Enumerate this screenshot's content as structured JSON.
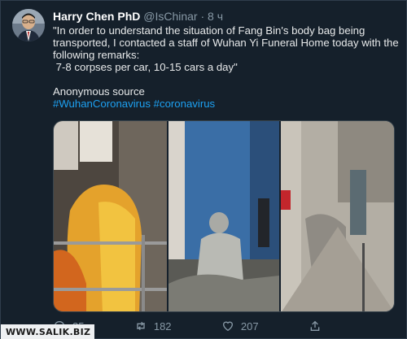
{
  "tweet": {
    "author_name": "Harry Chen PhD",
    "handle": "@IsChinar",
    "separator": "·",
    "time": "8 ч",
    "text_quote": "\"In order to understand the situation of Fang Bin's body bag being transported, I contacted a staff of Wuhan Yi Funeral Home today with the following remarks:\n 7-8 corpses per car, 10-15 cars a day\"",
    "source": "Anonymous source",
    "hashtags": "#WuhanCoronavirus #coronavirus"
  },
  "actions": {
    "replies": "25",
    "retweets": "182",
    "likes": "207"
  },
  "watermark": "WWW.SALIK.BIZ",
  "icons": [
    "reply-icon",
    "retweet-icon",
    "like-icon",
    "share-icon"
  ],
  "colors": {
    "background": "#15202b",
    "link": "#1da1f2",
    "muted": "#8899a6"
  }
}
